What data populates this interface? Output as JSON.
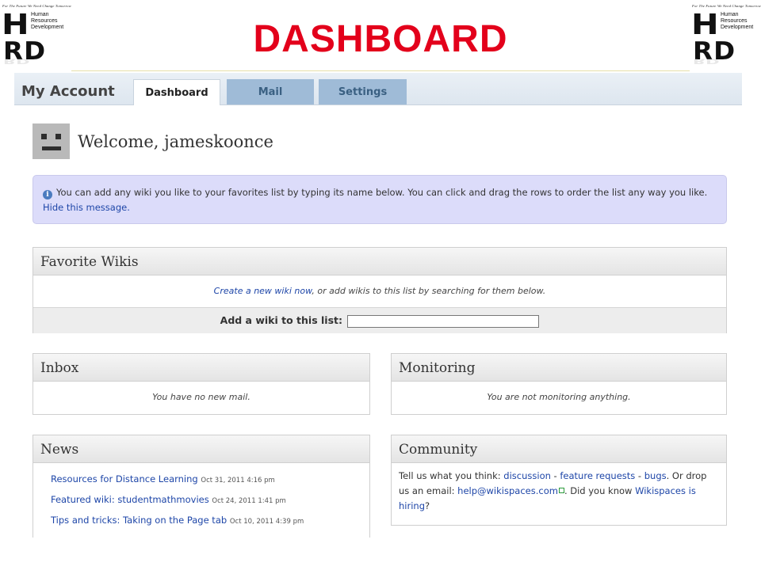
{
  "slide": {
    "title": "DASHBOARD",
    "logo": {
      "tagline": "For The Future We Need Change Tomorrow",
      "letters_top": "H",
      "letters_bottom": "RD",
      "words": [
        "Human",
        "Resources",
        "Development"
      ]
    }
  },
  "account": {
    "title": "My Account",
    "tabs": [
      "Dashboard",
      "Mail",
      "Settings"
    ]
  },
  "welcome": {
    "text": "Welcome, jameskoonce"
  },
  "info": {
    "icon": "info-icon",
    "message": "You can add any wiki you like to your favorites list by typing its name below. You can click and drag the rows to order the list any way you like.",
    "hide_link": "Hide this message."
  },
  "favorites": {
    "title": "Favorite Wikis",
    "create_link": "Create a new wiki now",
    "rest": ", or add wikis to this list by searching for them below.",
    "add_label": "Add a wiki to this list:",
    "add_value": ""
  },
  "inbox": {
    "title": "Inbox",
    "empty": "You have no new mail."
  },
  "monitoring": {
    "title": "Monitoring",
    "empty": "You are not monitoring anything."
  },
  "news": {
    "title": "News",
    "items": [
      {
        "link": "Resources for Distance Learning",
        "date": "Oct 31, 2011 4:16 pm"
      },
      {
        "link": "Featured wiki: studentmathmovies",
        "date": "Oct 24, 2011 1:41 pm"
      },
      {
        "link": "Tips and tricks: Taking on the Page tab",
        "date": "Oct 10, 2011 4:39 pm"
      }
    ]
  },
  "community": {
    "title": "Community",
    "t1": "Tell us what you think: ",
    "discussion": "discussion",
    "sep": " - ",
    "feature_requests": "feature requests",
    "bugs": "bugs",
    "t2": ". Or drop us an email: ",
    "email": "help@wikispaces.com",
    "t3": ". Did you know ",
    "hiring": "Wikispaces is hiring",
    "t4": "?"
  },
  "colors": {
    "title_red": "#e3001b",
    "link_blue": "#1e46a8",
    "info_bg": "#dcdcfa",
    "tab_inactive": "#9fbbd7"
  }
}
